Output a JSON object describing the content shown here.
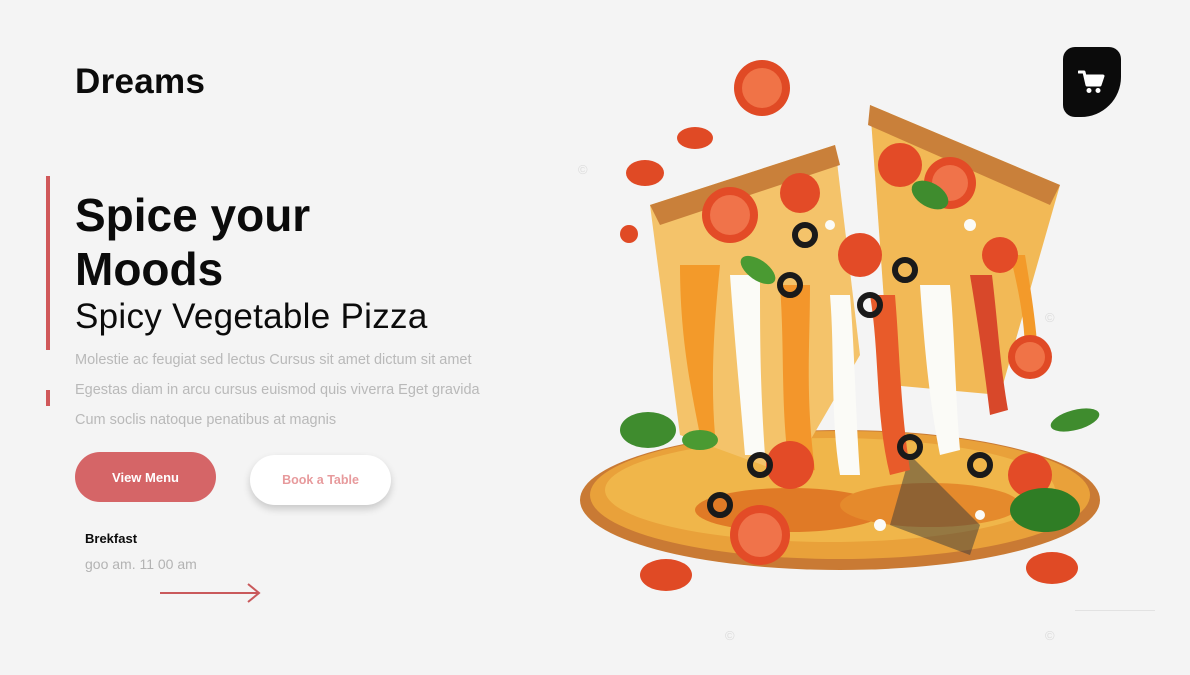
{
  "brand": {
    "name": "Dreams"
  },
  "hero": {
    "headline": "Spice your Moods",
    "subheadline": "Spicy Vegetable Pizza",
    "description_lines": [
      "Molestie ac feugiat sed lectus Cursus sit amet dictum sit amet",
      "Egestas diam in arcu cursus euismod quis viverra  Eget gravida",
      "Cum soclis natoque penatibus at magnis"
    ],
    "image_icon": "pizza-illustration"
  },
  "actions": {
    "primary_label": "View Menu",
    "secondary_label": "Book a Table"
  },
  "hours": {
    "label": "Brekfast",
    "time": "goo am. 11 00 am"
  },
  "cart": {
    "icon": "cart-icon"
  },
  "colors": {
    "accent": "#d0585a",
    "button_primary": "#d56567",
    "button_secondary_text": "#e79a9c",
    "background": "#f4f4f4",
    "text": "#0b0b0b",
    "muted": "#b9b9b9"
  }
}
